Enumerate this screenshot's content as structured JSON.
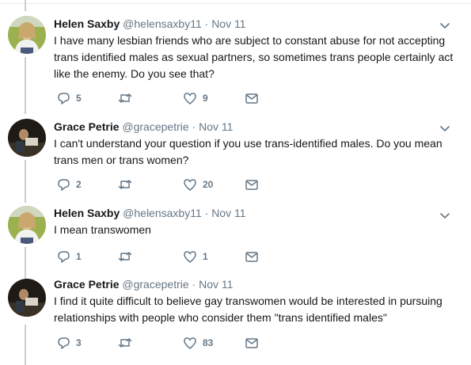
{
  "tweets": [
    {
      "name": "Helen Saxby",
      "handle": "@helensaxby11",
      "dot": "·",
      "time": "Nov 11",
      "lines": [
        "I have many lesbian friends who are subject to constant abuse for not accepting",
        "trans identified males as sexual partners, so sometimes trans people certainly act",
        "like the enemy. Do you see that?"
      ],
      "replies": "5",
      "retweets": "",
      "likes": "9",
      "avatar": "helen"
    },
    {
      "name": "Grace Petrie",
      "handle": "@gracepetrie",
      "dot": "·",
      "time": "Nov 11",
      "lines": [
        "I can't understand your question if you use trans-identified males. Do you mean",
        "trans men or trans women?"
      ],
      "replies": "2",
      "retweets": "",
      "likes": "20",
      "avatar": "grace"
    },
    {
      "name": "Helen Saxby",
      "handle": "@helensaxby11",
      "dot": "·",
      "time": "Nov 11",
      "lines": [
        "I mean transwomen"
      ],
      "replies": "1",
      "retweets": "",
      "likes": "1",
      "avatar": "helen"
    },
    {
      "name": "Grace Petrie",
      "handle": "@gracepetrie",
      "dot": "·",
      "time": "Nov 11",
      "lines": [
        "I find it quite difficult to believe gay transwomen would be interested in pursuing",
        "relationships with people who consider them \"trans identified males\""
      ],
      "replies": "3",
      "retweets": "",
      "likes": "83",
      "avatar": "grace"
    }
  ],
  "colors": {
    "thread_line": "#c4cfd6",
    "icon": "#657786",
    "divider": "#e6ecf0"
  },
  "icons": [
    "reply-icon",
    "retweet-icon",
    "like-icon",
    "direct-message-icon",
    "chevron-down-icon"
  ]
}
